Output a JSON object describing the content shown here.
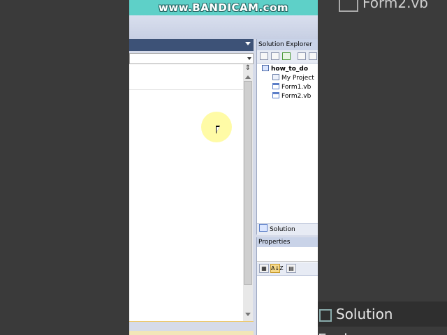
{
  "watermark": {
    "text": "www.BANDICAM.com"
  },
  "solution_explorer": {
    "title": "Solution Explorer",
    "project": "how_to_do",
    "items": [
      {
        "label": "My Project",
        "icon": "my-project-icon"
      },
      {
        "label": "Form1.vb",
        "icon": "form-file-icon"
      },
      {
        "label": "Form2.vb",
        "icon": "form-file-icon"
      }
    ],
    "tab_label": "Solution Explorer"
  },
  "properties": {
    "title": "Properties",
    "sort_button": "A↓Z"
  },
  "background": {
    "top_right_text": "Form2.vb",
    "bottom_right_text": "Solution Explorer"
  },
  "colors": {
    "title_bar": "#3d5277",
    "panel_header": "#c9d3e8",
    "watermark_bg": "#5ed0c8",
    "cursor_highlight": "#fffa96"
  }
}
